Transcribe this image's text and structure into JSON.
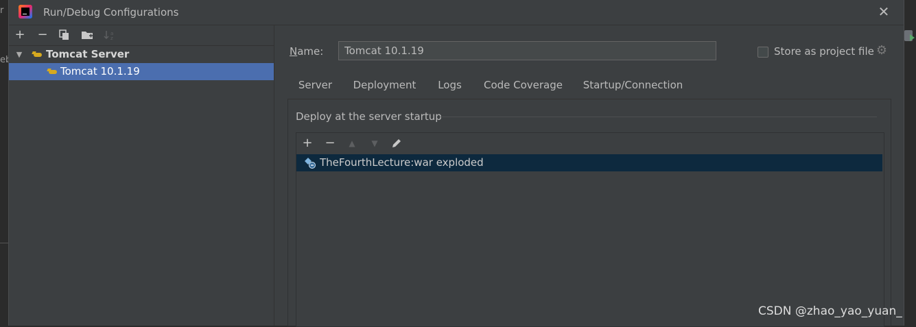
{
  "edge": {
    "left_text_1": "r",
    "left_text_2": "eb"
  },
  "dialog": {
    "title": "Run/Debug Configurations",
    "close_glyph": "✕"
  },
  "left_toolbar": {
    "add": "+",
    "remove": "−",
    "copy_icon": "copy-icon",
    "folder_icon": "new-folder-icon",
    "sort_icon": "sort-icon"
  },
  "tree": {
    "category": {
      "label": "Tomcat Server",
      "expanded": true,
      "icon": "tomcat-icon"
    },
    "items": [
      {
        "label": "Tomcat 10.1.19",
        "selected": true,
        "icon": "tomcat-icon"
      }
    ]
  },
  "config": {
    "name_label_mnemonic": "N",
    "name_label_rest": "ame:",
    "name_value": "Tomcat 10.1.19",
    "store_as_project_file": {
      "label": "Store as project file",
      "checked": false
    }
  },
  "tabs": [
    {
      "label": "Server",
      "active": false
    },
    {
      "label": "Deployment",
      "active": true
    },
    {
      "label": "Logs",
      "active": false
    },
    {
      "label": "Code Coverage",
      "active": false
    },
    {
      "label": "Startup/Connection",
      "active": false
    }
  ],
  "deployment": {
    "section_title": "Deploy at the server startup",
    "toolbar": {
      "add": "+",
      "remove": "−",
      "up": "▲",
      "down": "▼",
      "edit_icon": "pencil-icon"
    },
    "artifacts": [
      {
        "label": "TheFourthLecture:war exploded",
        "selected": true,
        "icon": "artifact-icon"
      }
    ]
  },
  "watermark": "CSDN @zhao_yao_yuan_",
  "colors": {
    "dialog_bg": "#3c3f41",
    "selection_blue": "#4b6eaf",
    "tab_underline": "#4a88c7",
    "artifact_selection": "#0d293e"
  }
}
